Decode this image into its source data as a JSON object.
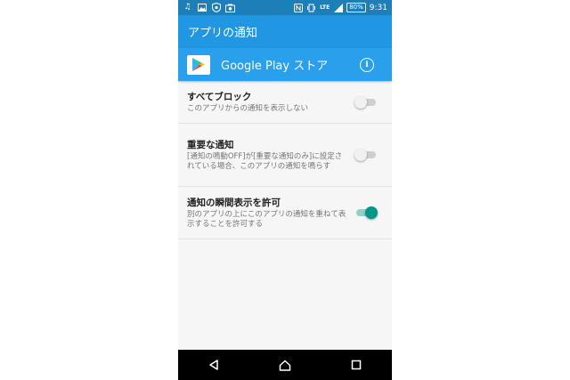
{
  "statusbar": {
    "left_icons": [
      "music-note-icon",
      "image-icon",
      "shield-icon",
      "camera-icon"
    ],
    "right_icons": [
      "nfc-icon",
      "vibrate-icon",
      "lte-icon",
      "signal-icon"
    ],
    "lte": "LTE",
    "battery": "80%",
    "time": "9:31"
  },
  "appbar": {
    "title": "アプリの通知"
  },
  "app_header": {
    "name": "Google Play ストア",
    "info_icon": "info-icon",
    "info_glyph": "i"
  },
  "settings": [
    {
      "title": "すべてブロック",
      "subtitle": "このアプリからの通知を表示しない",
      "enabled": false
    },
    {
      "title": "重要な通知",
      "subtitle": "[通知の鳴動OFF]が[重要な通知のみ]に設定されている場合、このアプリの通知を鳴らす",
      "enabled": false
    },
    {
      "title": "通知の瞬間表示を許可",
      "subtitle": "別のアプリの上にこのアプリの通知を重ねて表示することを許可する",
      "enabled": true
    }
  ],
  "colors": {
    "statusbar": "#1e7fb8",
    "appbar": "#2196e3",
    "header": "#2aa0ec",
    "switch_on": "#009688"
  },
  "navbar": {
    "buttons": [
      "back-icon",
      "home-icon",
      "recents-icon"
    ]
  }
}
